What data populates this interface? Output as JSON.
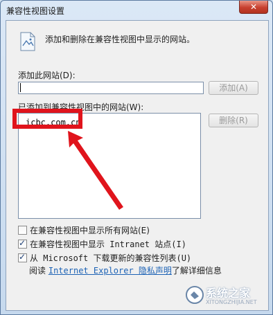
{
  "window": {
    "title": "兼容性视图设置",
    "close_label": "✕"
  },
  "intro": {
    "text": "添加和删除在兼容性视图中显示的网站。"
  },
  "add_site": {
    "label": "添加此网站(D):",
    "input_value": "",
    "add_button": "添加(A)"
  },
  "site_list": {
    "label": "已添加到兼容性视图中的网站(W):",
    "items": [
      "icbc.com.cn"
    ],
    "remove_button": "删除(R)"
  },
  "options": [
    {
      "checked": false,
      "label": "在兼容性视图中显示所有网站(E)"
    },
    {
      "checked": true,
      "label": "在兼容性视图中显示 Intranet 站点(I)"
    },
    {
      "checked": true,
      "label": "从 Microsoft 下载更新的兼容性列表(U)"
    }
  ],
  "privacy": {
    "prefix": "阅读",
    "link": "Internet Explorer 隐私声明",
    "suffix": "了解详细信息"
  },
  "watermark": {
    "text": "系统之家",
    "subtext": "XITONGZHIJIA.NET"
  },
  "colors": {
    "annotation_red": "#e0141c",
    "link_blue": "#1c62b5"
  }
}
